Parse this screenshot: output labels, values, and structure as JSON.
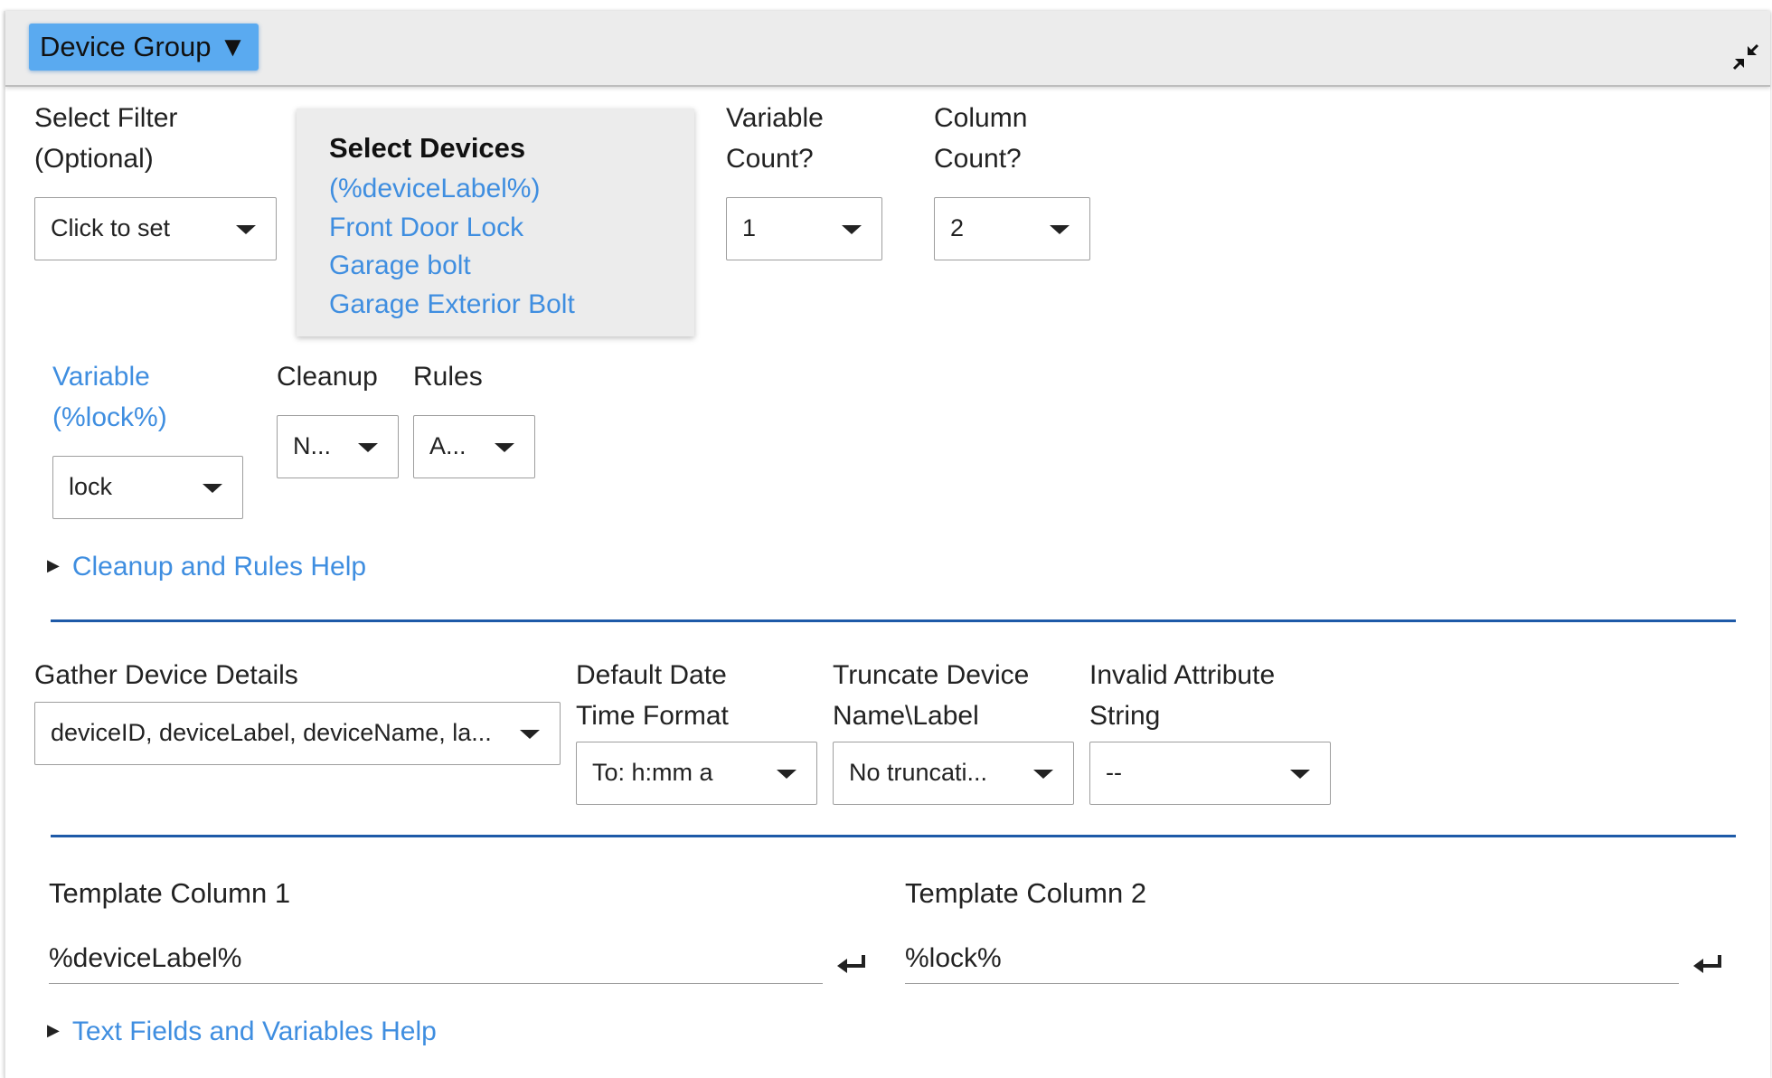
{
  "header": {
    "group_label": "Device Group ▼",
    "collapse_icon": "collapse-arrows-icon"
  },
  "filter": {
    "label_line1": "Select Filter",
    "label_line2": "(Optional)",
    "value": "Click to set"
  },
  "devices": {
    "title": "Select Devices",
    "items": [
      "(%deviceLabel%)",
      "Front Door Lock",
      "Garage bolt",
      "Garage Exterior Bolt"
    ]
  },
  "variable_count": {
    "label_line1": "Variable",
    "label_line2": "Count?",
    "value": "1"
  },
  "column_count": {
    "label_line1": "Column",
    "label_line2": "Count?",
    "value": "2"
  },
  "variable": {
    "label_line1": "Variable",
    "label_line2": "(%lock%)",
    "value": "lock"
  },
  "cleanup": {
    "label": "Cleanup",
    "value": "N..."
  },
  "rules": {
    "label": "Rules",
    "value": "A..."
  },
  "help1": {
    "label": "Cleanup and Rules Help"
  },
  "gather": {
    "label": "Gather Device Details",
    "value": "deviceID, deviceLabel, deviceName, la..."
  },
  "date_format": {
    "label_line1": "Default Date",
    "label_line2": "Time Format",
    "value": "To: h:mm a"
  },
  "truncate": {
    "label_line1": "Truncate Device",
    "label_line2": "Name\\Label",
    "value": "No truncati..."
  },
  "invalid": {
    "label_line1": "Invalid Attribute",
    "label_line2": "String",
    "value": "--"
  },
  "template1": {
    "label": "Template Column 1",
    "value": "%deviceLabel%"
  },
  "template2": {
    "label": "Template Column 2",
    "value": "%lock%"
  },
  "help2": {
    "label": "Text Fields and Variables Help"
  },
  "colors": {
    "accent_blue": "#3f8ee0",
    "header_button": "#5aaaf0",
    "divider": "#1e5aa8"
  }
}
